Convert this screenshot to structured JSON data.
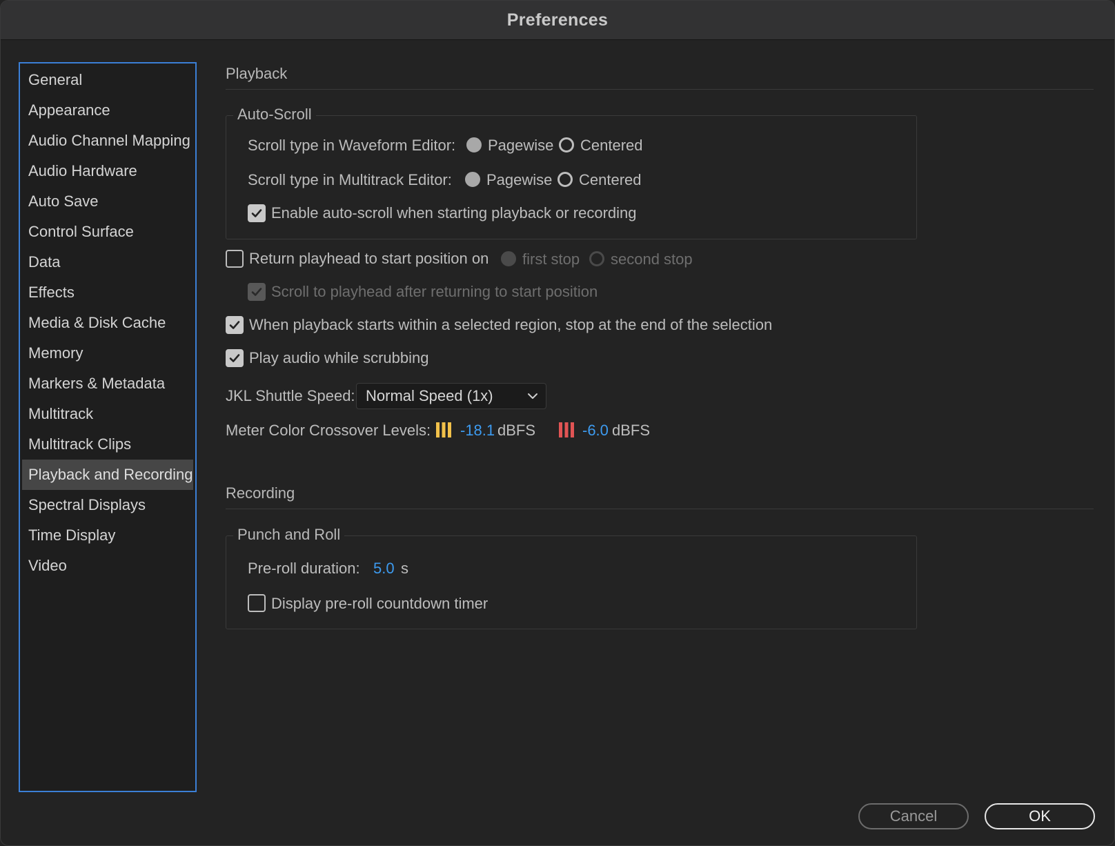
{
  "window": {
    "title": "Preferences"
  },
  "sidebar": {
    "selected": "Playback and Recording",
    "items": [
      {
        "label": "General"
      },
      {
        "label": "Appearance"
      },
      {
        "label": "Audio Channel Mapping"
      },
      {
        "label": "Audio Hardware"
      },
      {
        "label": "Auto Save"
      },
      {
        "label": "Control Surface"
      },
      {
        "label": "Data"
      },
      {
        "label": "Effects"
      },
      {
        "label": "Media & Disk Cache"
      },
      {
        "label": "Memory"
      },
      {
        "label": "Markers & Metadata"
      },
      {
        "label": "Multitrack"
      },
      {
        "label": "Multitrack Clips"
      },
      {
        "label": "Playback and Recording"
      },
      {
        "label": "Spectral Displays"
      },
      {
        "label": "Time Display"
      },
      {
        "label": "Video"
      }
    ]
  },
  "playback": {
    "title": "Playback",
    "auto_scroll": {
      "legend": "Auto-Scroll",
      "waveform": {
        "label": "Scroll type in Waveform Editor:",
        "option1": "Pagewise",
        "option2": "Centered",
        "selected": "Pagewise"
      },
      "multitrack": {
        "label": "Scroll type in Multitrack Editor:",
        "option1": "Pagewise",
        "option2": "Centered",
        "selected": "Pagewise"
      },
      "enable_autoscroll": {
        "label": "Enable auto-scroll when starting playback or recording",
        "checked": true
      }
    },
    "return_playhead": {
      "label": "Return playhead to start position on",
      "checked": false,
      "option1": "first stop",
      "option2": "second stop",
      "selected": "first stop"
    },
    "scroll_to_playhead": {
      "label": "Scroll to playhead after returning to start position",
      "checked": true,
      "disabled": true
    },
    "stop_at_selection_end": {
      "label": "When playback starts within a selected region, stop at the end of the selection",
      "checked": true
    },
    "scrub_audio": {
      "label": "Play audio while scrubbing",
      "checked": true
    },
    "jkl": {
      "label": "JKL Shuttle Speed:",
      "value": "Normal Speed (1x)"
    },
    "meter": {
      "label": "Meter Color Crossover Levels:",
      "yellow_value": "-18.1",
      "red_value": "-6.0",
      "unit": "dBFS",
      "yellow_color": "#f2c14a",
      "red_color": "#e05454"
    }
  },
  "recording": {
    "title": "Recording",
    "punch_and_roll": {
      "legend": "Punch and Roll",
      "preroll": {
        "label": "Pre-roll duration:",
        "value": "5.0",
        "unit": "s"
      },
      "countdown": {
        "label": "Display pre-roll countdown timer",
        "checked": false
      }
    }
  },
  "buttons": {
    "cancel": "Cancel",
    "ok": "OK"
  },
  "colors": {
    "accent": "#3b7fd6",
    "value_link": "#3d9bf0"
  }
}
